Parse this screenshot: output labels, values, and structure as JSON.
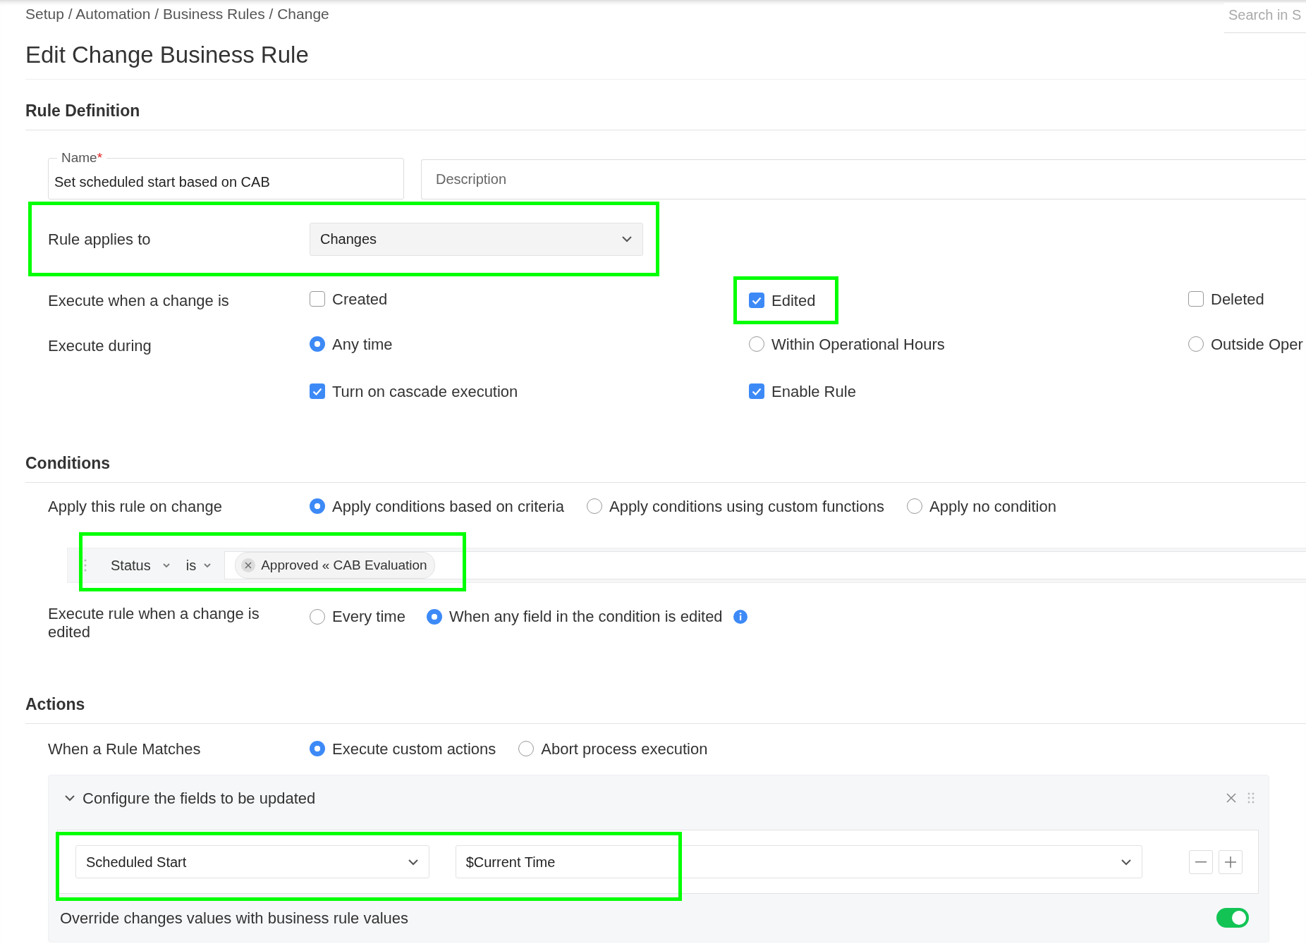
{
  "breadcrumb": "Setup / Automation / Business Rules / Change",
  "search": {
    "placeholder": "Search in S"
  },
  "title": "Edit Change Business Rule",
  "rule_definition": {
    "heading": "Rule Definition",
    "name_field": {
      "label": "Name",
      "required_mark": "*",
      "value": "Set scheduled start based on CAB"
    },
    "description_field": {
      "placeholder": "Description"
    },
    "applies_to": {
      "label": "Rule applies to",
      "value": "Changes",
      "highlighted": true
    },
    "execute_when": {
      "label": "Execute when a change is",
      "options": [
        {
          "label": "Created",
          "checked": false,
          "highlighted": false
        },
        {
          "label": "Edited",
          "checked": true,
          "highlighted": true
        },
        {
          "label": "Deleted",
          "checked": false,
          "highlighted": false
        }
      ]
    },
    "execute_during": {
      "label": "Execute during",
      "options": [
        {
          "label": "Any time",
          "selected": true
        },
        {
          "label": "Within Operational Hours",
          "selected": false
        },
        {
          "label": "Outside Oper",
          "selected": false
        }
      ]
    },
    "extra_options": [
      {
        "label": "Turn on cascade execution",
        "checked": true
      },
      {
        "label": "Enable Rule",
        "checked": true
      }
    ]
  },
  "conditions": {
    "heading": "Conditions",
    "apply_on": {
      "label": "Apply this rule on change",
      "options": [
        {
          "label": "Apply conditions based on criteria",
          "selected": true
        },
        {
          "label": "Apply conditions using custom functions",
          "selected": false
        },
        {
          "label": "Apply no condition",
          "selected": false
        }
      ]
    },
    "criteria": {
      "field": "Status",
      "operator": "is",
      "values": [
        "Approved « CAB Evaluation"
      ],
      "highlighted": true
    },
    "execute_on_edit": {
      "label": "Execute rule when a change is edited",
      "options": [
        {
          "label": "Every time",
          "selected": false
        },
        {
          "label": "When any field in the condition is edited",
          "selected": true
        }
      ]
    }
  },
  "actions": {
    "heading": "Actions",
    "on_match": {
      "label": "When a Rule Matches",
      "options": [
        {
          "label": "Execute custom actions",
          "selected": true
        },
        {
          "label": "Abort process execution",
          "selected": false
        }
      ]
    },
    "panel": {
      "title": "Configure the fields to be updated",
      "expanded": true,
      "updates": [
        {
          "field": "Scheduled Start",
          "value": "$Current Time",
          "highlighted": true
        }
      ],
      "override": {
        "label": "Override changes values with business rule values",
        "on": true
      }
    }
  }
}
